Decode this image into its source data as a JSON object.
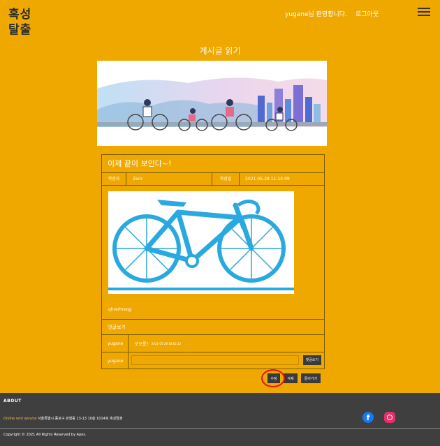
{
  "header": {
    "logo_line1": "혹성",
    "logo_line2": "탈출",
    "welcome": "yugane님 환영합니다.",
    "logout": "로그아웃"
  },
  "page_heading": "게시글 읽기",
  "post": {
    "title": "이제 끝이 보인다~!",
    "author_label": "작성자",
    "author": "Zero",
    "date_label": "작성일",
    "date": "2021-05-28 11:14:09",
    "body": "qhrerhreqg"
  },
  "comments": {
    "heading": "댓글보기",
    "items": [
      {
        "user": "yugane",
        "text": "오오롱?",
        "date": "2021-05-28 18:02:22"
      }
    ],
    "input_user": "yugane",
    "input_value": "",
    "write_button": "댓글쓰기"
  },
  "actions": {
    "edit": "수정",
    "delete": "삭제",
    "back": "돌아가기"
  },
  "footer": {
    "about": "ABOUT",
    "service": "Online rent service",
    "address": "서울특별시 종로구 관철동 13-13 10층 1014호 혹성탈출",
    "copyright": "Copyright © 2021 All Rights Reserved by Apes."
  },
  "colors": {
    "background": "#efa800",
    "footer": "#3f3f3f",
    "bike": "#29a9e0"
  }
}
